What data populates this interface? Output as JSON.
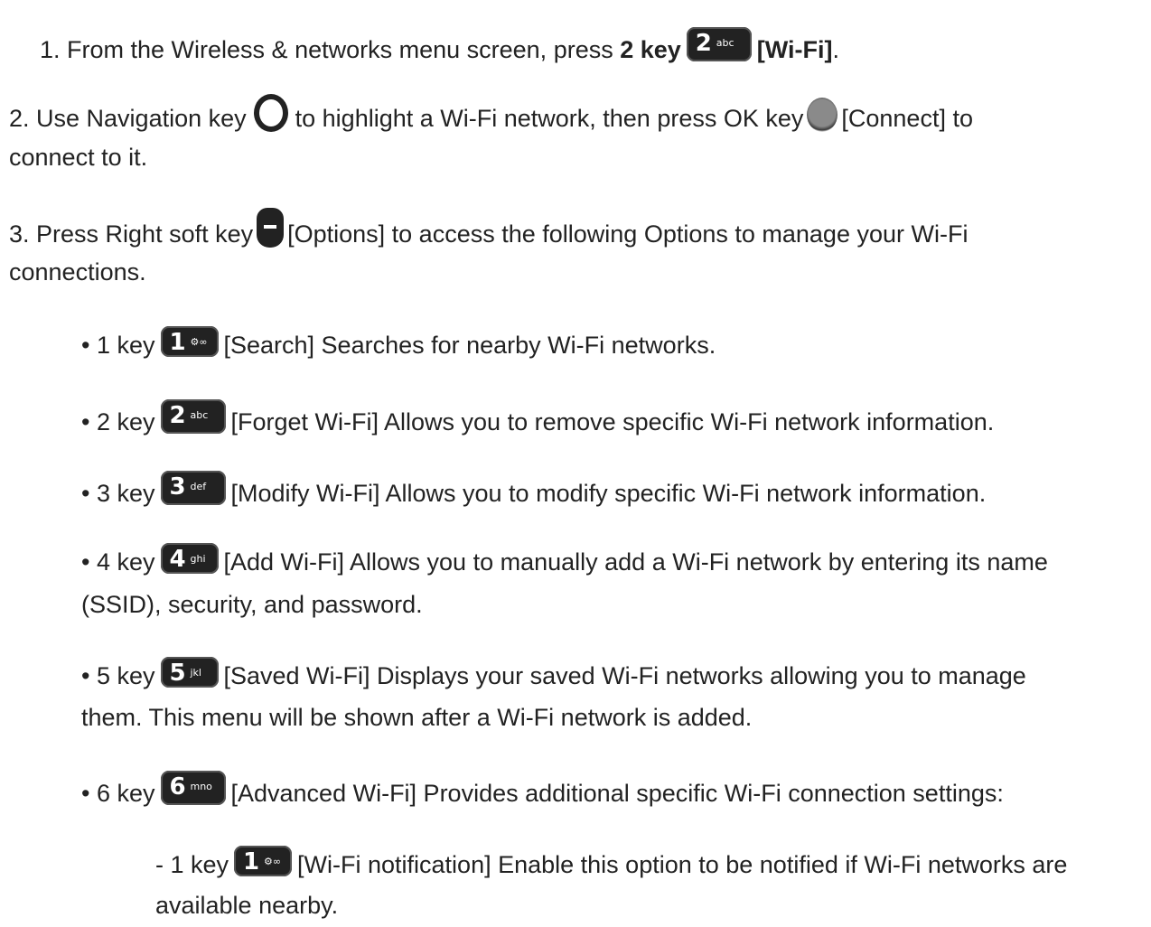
{
  "steps": {
    "step1": {
      "prefix": "1. From the Wireless & networks menu screen, press ",
      "bold_key": "2 key",
      "key_icon": {
        "name": "key-2-icon",
        "main": "2",
        "sub": "abc"
      },
      "bold_label": "[Wi-Fi]",
      "suffix": "."
    },
    "step2": {
      "part1": "2. Use Navigation key",
      "part2": "to highlight a Wi-Fi network, then press OK key",
      "part3": "[Connect] to",
      "line2": "connect to it."
    },
    "step3": {
      "part1": "3. Press Right soft key",
      "part2": "[Options] to access the following Options to manage your Wi-Fi",
      "line2": "connections."
    }
  },
  "options": [
    {
      "prefix": "• 1 key",
      "key_main": "1",
      "key_sub": "⚙∞",
      "text": "[Search] Searches for nearby Wi-Fi networks.",
      "text2": ""
    },
    {
      "prefix": "• 2 key",
      "key_main": "2",
      "key_sub": "abc",
      "text": "[Forget Wi-Fi] Allows you to remove specific Wi-Fi network information.",
      "text2": ""
    },
    {
      "prefix": "• 3 key",
      "key_main": "3",
      "key_sub": "def",
      "text": "[Modify Wi-Fi] Allows you to modify specific Wi-Fi network information.",
      "text2": ""
    },
    {
      "prefix": "• 4 key",
      "key_main": "4",
      "key_sub": "ghi",
      "text": "[Add Wi-Fi] Allows you to manually add a Wi-Fi network by entering its name",
      "text2": "(SSID), security, and password."
    },
    {
      "prefix": "• 5 key",
      "key_main": "5",
      "key_sub": "jkl",
      "text": "[Saved Wi-Fi] Displays your saved Wi-Fi networks allowing you to manage",
      "text2": "them. This menu will be shown after a Wi-Fi network is added."
    },
    {
      "prefix": "• 6 key",
      "key_main": "6",
      "key_sub": "mno",
      "text": "[Advanced Wi-Fi] Provides additional specific Wi-Fi connection settings:",
      "text2": ""
    }
  ],
  "sub_options": [
    {
      "prefix": "- 1 key",
      "key_main": "1",
      "key_sub": "⚙∞",
      "text": "[Wi-Fi notification] Enable this option to be notified if Wi-Fi networks are",
      "text2": "available nearby."
    }
  ],
  "colors": {
    "text": "#222222",
    "key_bg": "#222222",
    "ok_key": "#8a8a8a"
  }
}
